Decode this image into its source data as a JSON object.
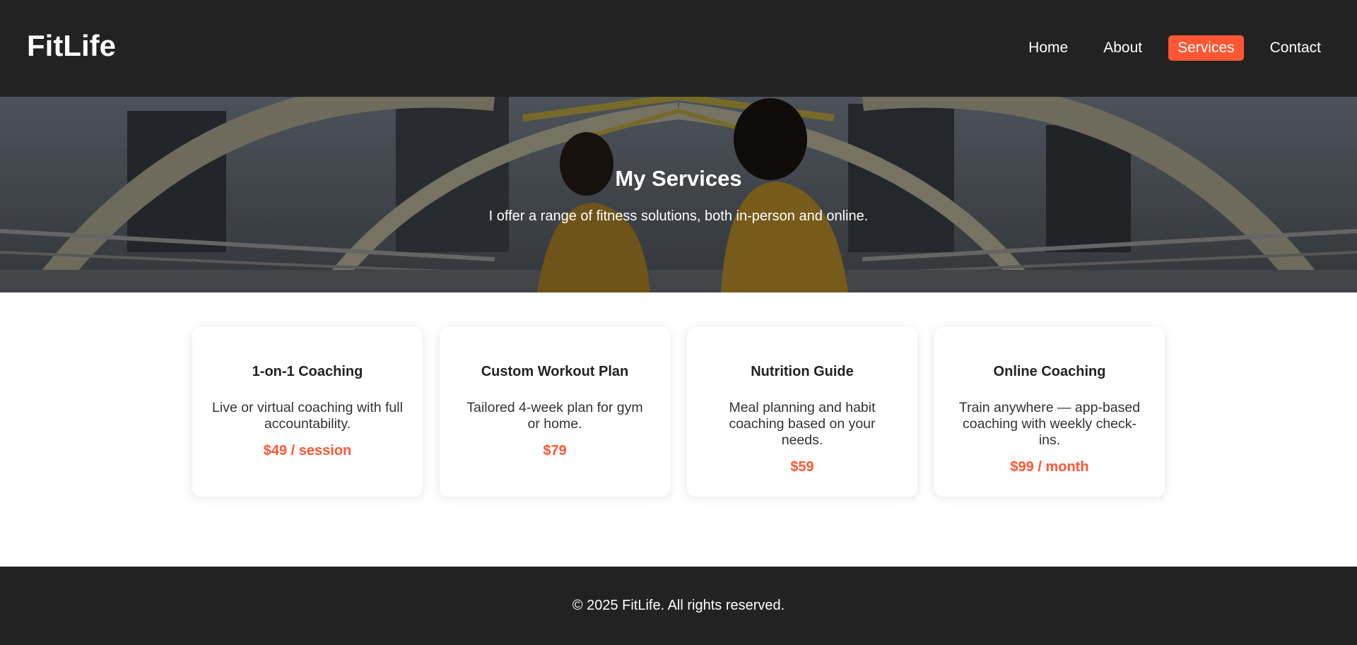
{
  "brand": {
    "name": "FitLife"
  },
  "nav": {
    "items": [
      {
        "label": "Home"
      },
      {
        "label": "About"
      },
      {
        "label": "Services",
        "active": true
      },
      {
        "label": "Contact"
      }
    ]
  },
  "hero": {
    "title": "My Services",
    "subtitle": "I offer a range of fitness solutions, both in-person and online."
  },
  "services": [
    {
      "title": "1-on-1 Coaching",
      "description": "Live or virtual coaching with full accountability.",
      "price": "$49 / session"
    },
    {
      "title": "Custom Workout Plan",
      "description": "Tailored 4-week plan for gym or home.",
      "price": "$79"
    },
    {
      "title": "Nutrition Guide",
      "description": "Meal planning and habit coaching based on your needs.",
      "price": "$59"
    },
    {
      "title": "Online Coaching",
      "description": "Train anywhere — app-based coaching with weekly check-ins.",
      "price": "$99 / month"
    }
  ],
  "footer": {
    "text": "© 2025 FitLife. All rights reserved."
  },
  "colors": {
    "accent": "#ff5733",
    "dark": "#222222"
  }
}
